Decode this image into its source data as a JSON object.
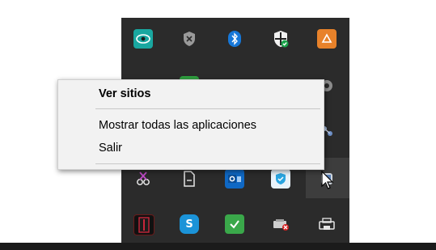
{
  "context_menu": {
    "items": [
      {
        "label": "Ver sitios",
        "bold": true
      },
      {
        "label": "Mostrar todas las aplicaciones",
        "bold": false
      },
      {
        "label": "Salir",
        "bold": false
      }
    ]
  },
  "tray_icons": {
    "row1": [
      "eye-app-icon",
      "shield-gray-icon",
      "bluetooth-icon",
      "windows-security-icon",
      "orange-app-icon"
    ],
    "row4": [
      "scissors-app-icon",
      "document-icon",
      "outlook-icon",
      "vpn-shield-icon",
      "mouse-app-icon"
    ],
    "row5": [
      "red-book-icon",
      "skype-icon",
      "green-check-icon",
      "device-error-icon",
      "printer-icon"
    ],
    "skype_letter": "S"
  },
  "colors": {
    "tray_background": "#2b2b2b",
    "menu_background": "#f2f2f2",
    "taskbar": "#1b1b1b"
  }
}
